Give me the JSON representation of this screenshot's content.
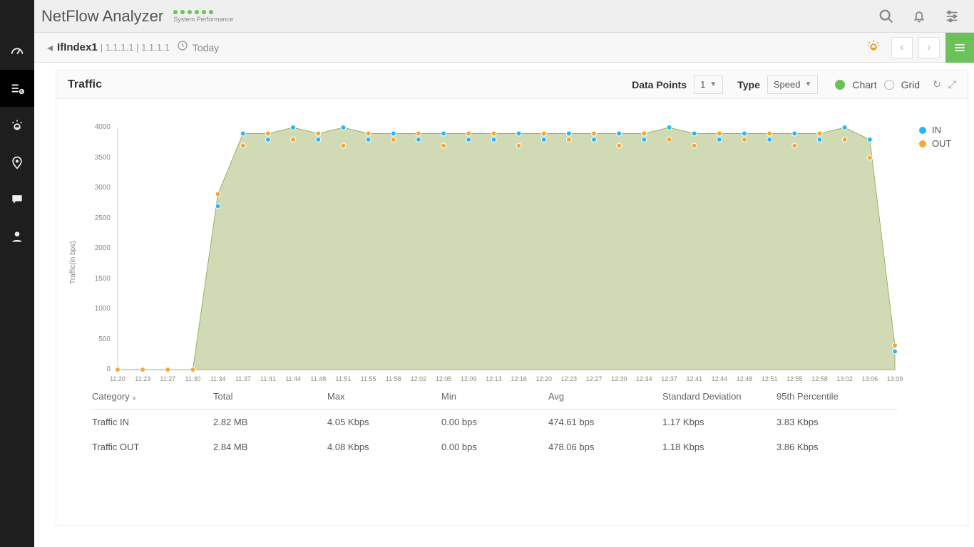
{
  "header": {
    "app_title": "NetFlow Analyzer",
    "perf_label": "System Performance",
    "perf_dots": 6
  },
  "subheader": {
    "interface_name": "IfIndex1",
    "path": "| 1.1.1.1 | 1.1.1.1",
    "timeframe": "Today"
  },
  "panel": {
    "title": "Traffic",
    "data_points_label": "Data Points",
    "data_points_value": "1",
    "type_label": "Type",
    "type_value": "Speed",
    "chart_label": "Chart",
    "grid_label": "Grid"
  },
  "legend": {
    "in": "IN",
    "out": "OUT"
  },
  "colors": {
    "in": "#29b6f6",
    "out": "#f0a83a",
    "fill": "rgba(170,190,120,0.55)"
  },
  "table": {
    "headers": [
      "Category",
      "Total",
      "Max",
      "Min",
      "Avg",
      "Standard Deviation",
      "95th Percentile"
    ],
    "rows": [
      {
        "cat": "Traffic IN",
        "total": "2.82 MB",
        "max": "4.05 Kbps",
        "min": "0.00 bps",
        "avg": "474.61 bps",
        "sd": "1.17 Kbps",
        "p95": "3.83 Kbps"
      },
      {
        "cat": "Traffic OUT",
        "total": "2.84 MB",
        "max": "4.08 Kbps",
        "min": "0.00 bps",
        "avg": "478.06 bps",
        "sd": "1.18 Kbps",
        "p95": "3.86 Kbps"
      }
    ]
  },
  "chart_data": {
    "type": "area",
    "ylabel": "Traffic(in bps)",
    "ylim": [
      0,
      4000
    ],
    "yticks": [
      0,
      500,
      1000,
      1500,
      2000,
      2500,
      3000,
      3500,
      4000
    ],
    "categories": [
      "11:20",
      "11:23",
      "11:27",
      "11:30",
      "11:34",
      "11:37",
      "11:41",
      "11:44",
      "11:48",
      "11:51",
      "11:55",
      "11:58",
      "12:02",
      "12:05",
      "12:09",
      "12:13",
      "12:16",
      "12:20",
      "12:23",
      "12:27",
      "12:30",
      "12:34",
      "12:37",
      "12:41",
      "12:44",
      "12:48",
      "12:51",
      "12:55",
      "12:58",
      "13:02",
      "13:06",
      "13:09"
    ],
    "series": [
      {
        "name": "IN",
        "values": [
          0,
          0,
          0,
          0,
          2700,
          3900,
          3800,
          4000,
          3800,
          4000,
          3800,
          3900,
          3800,
          3900,
          3800,
          3800,
          3900,
          3800,
          3900,
          3800,
          3900,
          3800,
          4000,
          3900,
          3800,
          3900,
          3800,
          3900,
          3800,
          4000,
          3800,
          300
        ]
      },
      {
        "name": "OUT",
        "values": [
          0,
          0,
          0,
          0,
          2900,
          3700,
          3900,
          3800,
          3900,
          3700,
          3900,
          3800,
          3900,
          3700,
          3900,
          3900,
          3700,
          3900,
          3800,
          3900,
          3700,
          3900,
          3800,
          3700,
          3900,
          3800,
          3900,
          3700,
          3900,
          3800,
          3500,
          400
        ]
      }
    ]
  }
}
